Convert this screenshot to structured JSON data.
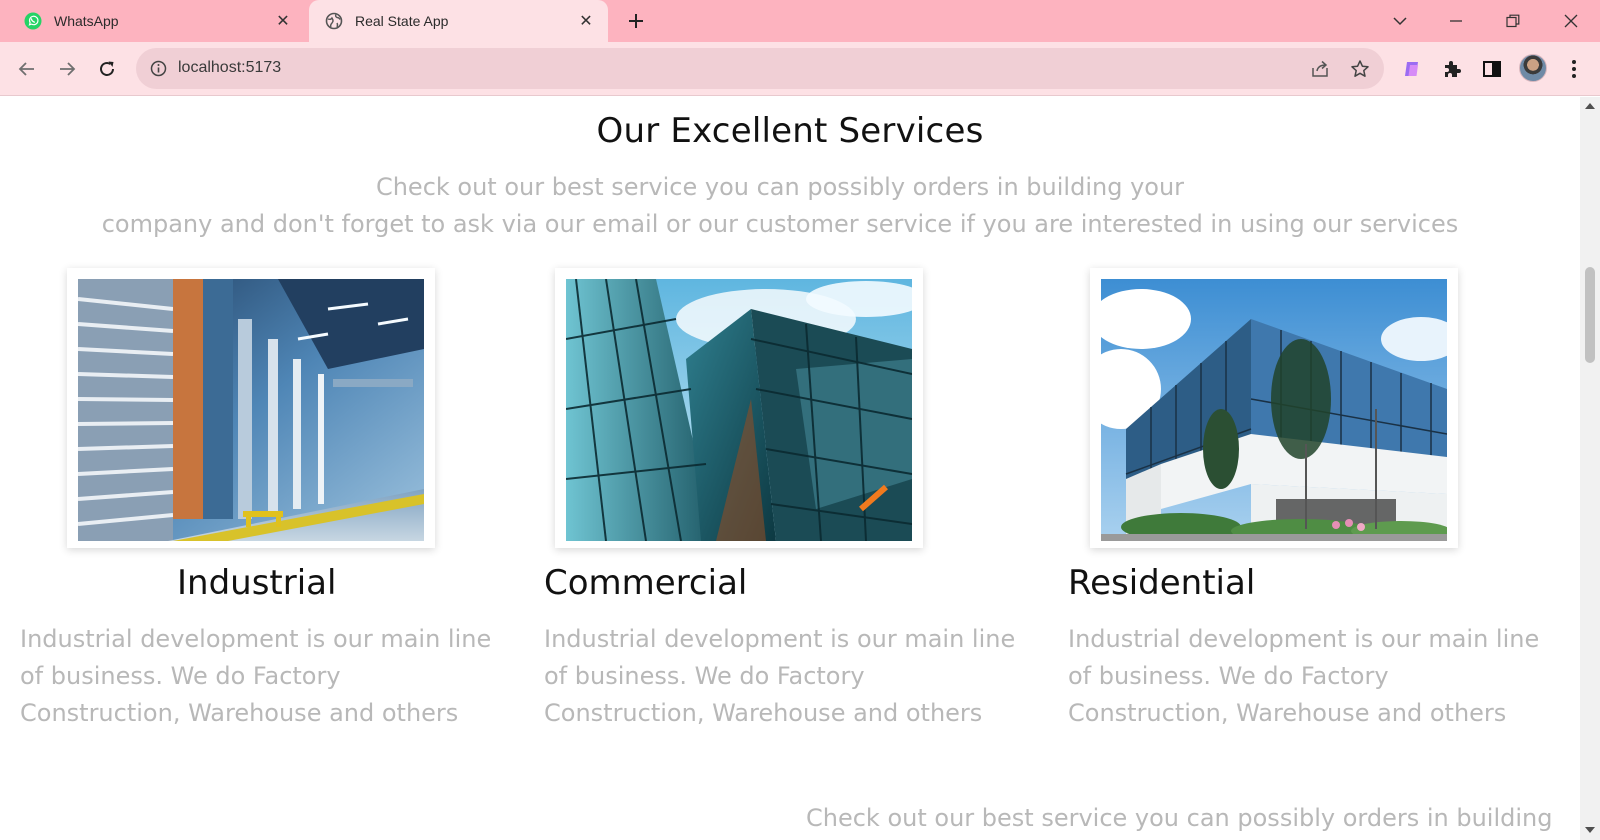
{
  "browser": {
    "tabs": [
      {
        "title": "WhatsApp",
        "favicon": "whatsapp-icon",
        "active": false
      },
      {
        "title": "Real State App",
        "favicon": "globe-icon",
        "active": true
      }
    ],
    "url": "localhost:5173",
    "colors": {
      "tabstrip": "#fdb3bf",
      "toolbar": "#fde1e5",
      "omnibox": "#f0cfd5"
    }
  },
  "page": {
    "section_title": "Our Excellent Services",
    "section_subtitle_line1": "Check out our best service you can possibly orders in building your",
    "section_subtitle_line2": "company and don't forget to ask via our email or our customer service if you are interested in using our services",
    "services": [
      {
        "title": "Industrial",
        "description": "Industrial development is our main line of business. We do Factory Construction, Warehouse and others",
        "image": "warehouse-photo"
      },
      {
        "title": "Commercial",
        "description": "Industrial development is our main line of business. We do Factory Construction, Warehouse and others",
        "image": "glass-tower-photo"
      },
      {
        "title": "Residential",
        "description": "Industrial development is our main line of business. We do Factory Construction, Warehouse and others",
        "image": "office-building-photo"
      }
    ],
    "bottom_text": "Check out our best service you can possibly orders in building"
  }
}
